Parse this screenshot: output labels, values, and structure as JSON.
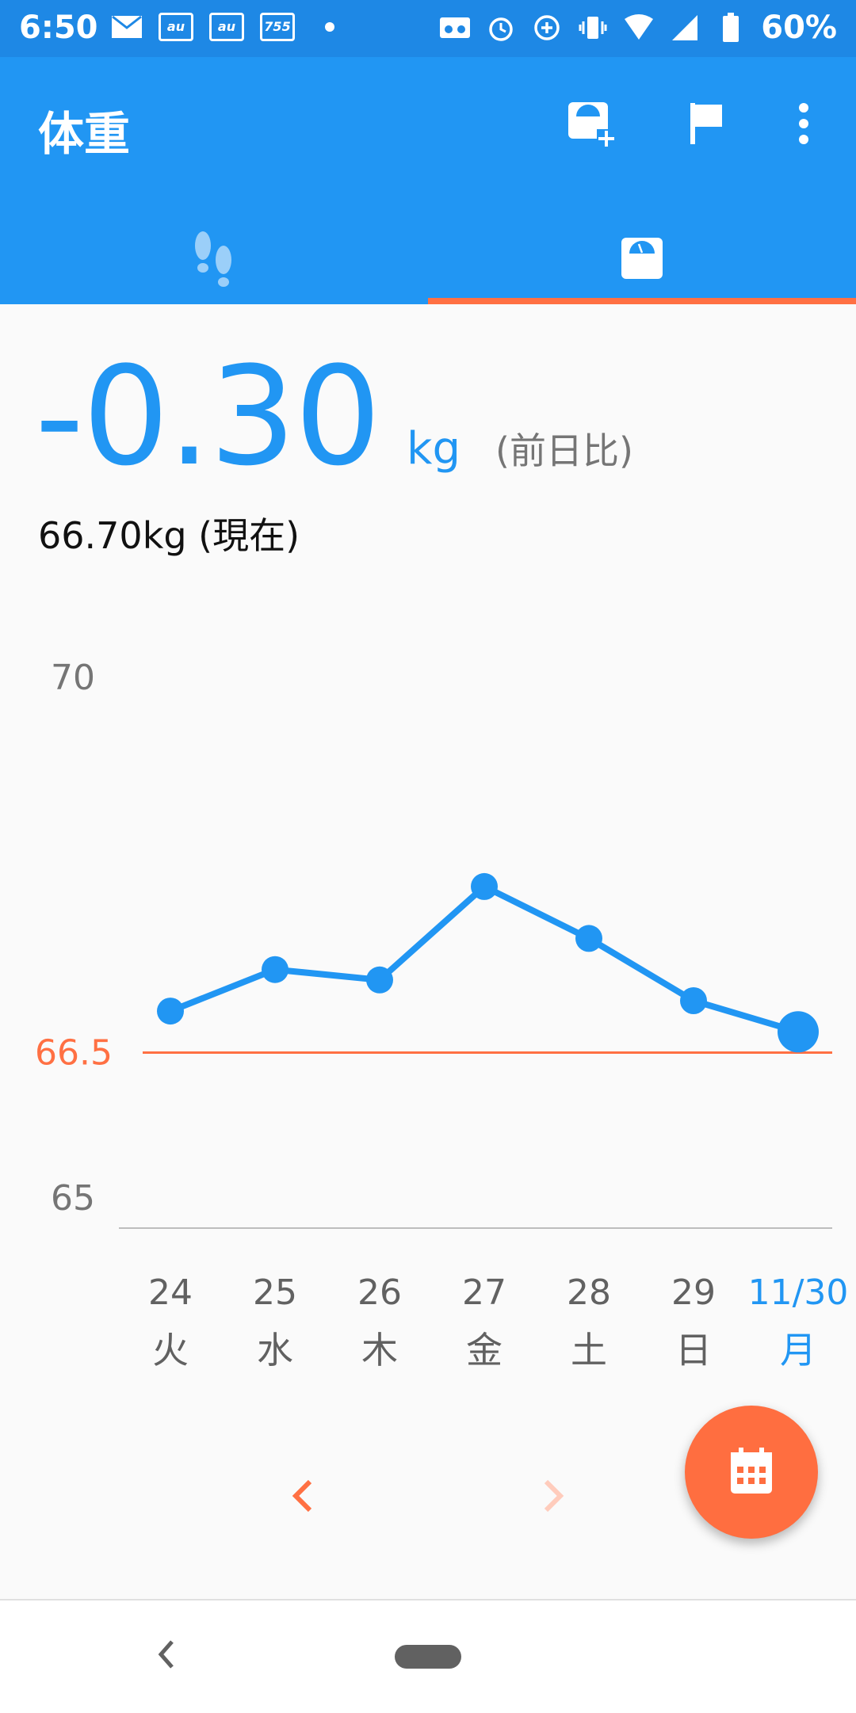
{
  "status_bar": {
    "time": "6:50",
    "left_icons": [
      "mail-icon",
      "au-icon",
      "au-icon",
      "755-icon"
    ],
    "au_text": "au",
    "badge_text": "755",
    "right_icons": [
      "voicemail-icon",
      "alarm-icon",
      "data-saver-icon",
      "vibrate-icon",
      "wifi-icon",
      "signal-icon",
      "battery-icon"
    ],
    "battery": "60%"
  },
  "app_bar": {
    "title": "体重",
    "actions": [
      "add-weight-icon",
      "flag-icon",
      "more-icon"
    ],
    "tabs": [
      {
        "name": "steps",
        "icon": "footsteps-icon",
        "selected": false
      },
      {
        "name": "weight",
        "icon": "scale-icon",
        "selected": true
      }
    ]
  },
  "summary": {
    "delta_value": "-0.30",
    "delta_unit": "kg",
    "delta_note": "(前日比)",
    "current": "66.70kg (現在)"
  },
  "chart_data": {
    "type": "line",
    "x_dates": [
      "24",
      "25",
      "26",
      "27",
      "28",
      "29",
      "11/30"
    ],
    "x_weekdays": [
      "火",
      "水",
      "木",
      "金",
      "土",
      "日",
      "月"
    ],
    "values": [
      66.9,
      67.3,
      67.2,
      68.1,
      67.6,
      67.0,
      66.7
    ],
    "y_ticks": [
      65,
      70
    ],
    "ylim": [
      65,
      70
    ],
    "goal_line": 66.5,
    "goal_label": "66.5",
    "line_color": "#2196F3",
    "goal_color": "#FF7043",
    "highlight_index": 6
  },
  "colors": {
    "primary": "#2196F3",
    "accent": "#FF6E40"
  }
}
